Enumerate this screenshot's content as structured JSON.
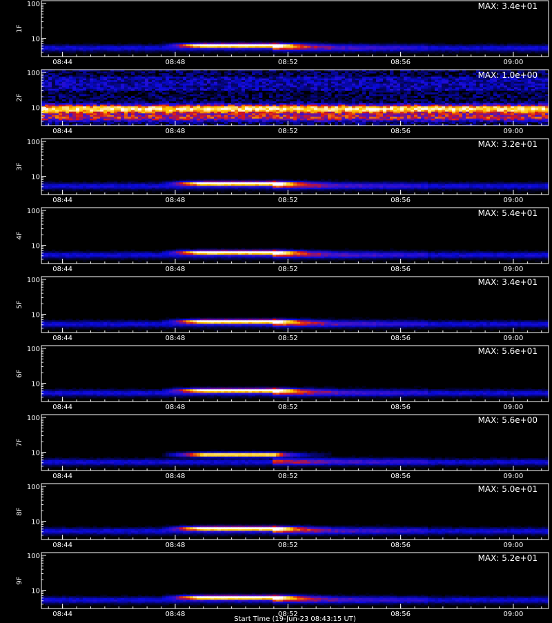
{
  "chart_data": {
    "type": "heatmap",
    "xlabel": "Start Time (19-Jun-23 08:43:15 UT)",
    "x_ticks": [
      "08:44",
      "08:48",
      "08:52",
      "08:56",
      "09:00"
    ],
    "x_range": [
      "08:43:15",
      "09:01:15"
    ],
    "y_ticks": [
      "10",
      "100"
    ],
    "y_scale": "log",
    "colormap": "black-blue-red-yellow-white",
    "panels": [
      {
        "name": "1F",
        "max_label": "MAX: 3.4e+01",
        "max": 34
      },
      {
        "name": "2F",
        "max_label": "MAX: 1.0e+00",
        "max": 1.0
      },
      {
        "name": "3F",
        "max_label": "MAX: 3.2e+01",
        "max": 32
      },
      {
        "name": "4F",
        "max_label": "MAX: 5.4e+01",
        "max": 54
      },
      {
        "name": "5F",
        "max_label": "MAX: 3.4e+01",
        "max": 34
      },
      {
        "name": "6F",
        "max_label": "MAX: 5.6e+01",
        "max": 56
      },
      {
        "name": "7F",
        "max_label": "MAX: 5.6e+00",
        "max": 5.6
      },
      {
        "name": "8F",
        "max_label": "MAX: 5.0e+01",
        "max": 50
      },
      {
        "name": "9F",
        "max_label": "MAX: 5.2e+01",
        "max": 52
      }
    ]
  }
}
